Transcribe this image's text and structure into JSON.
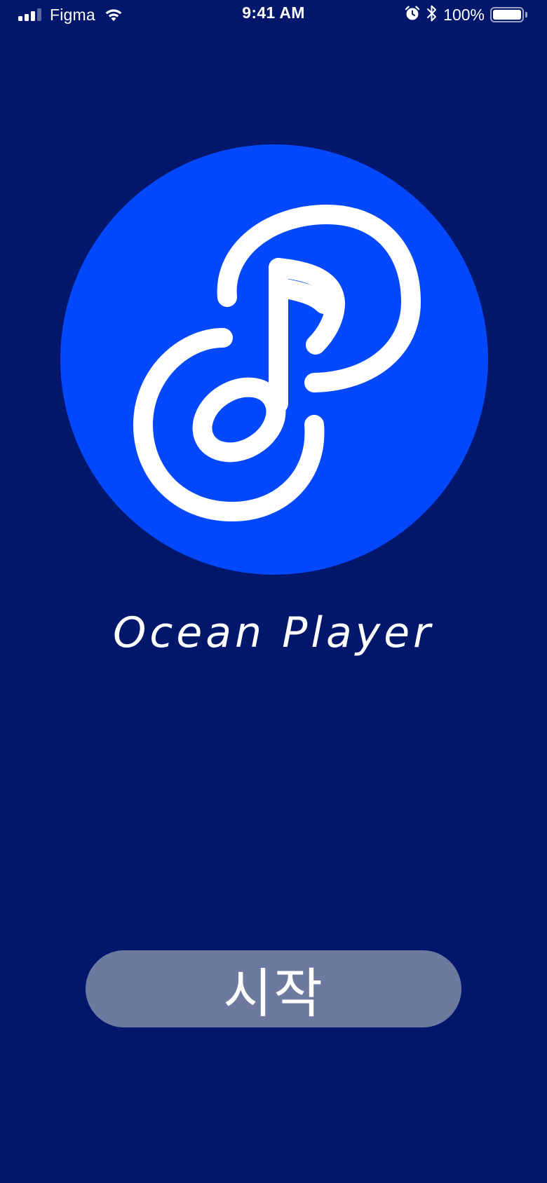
{
  "status_bar": {
    "carrier": "Figma",
    "time": "9:41 AM",
    "battery_percent": "100%",
    "icons": [
      "signal-icon",
      "wifi-icon",
      "alarm-icon",
      "bluetooth-icon",
      "battery-icon"
    ]
  },
  "app": {
    "name": "Ocean Player",
    "logo_icon": "music-note-icon"
  },
  "start_button": {
    "label": "시작"
  },
  "colors": {
    "background": "#00176b",
    "logo_circle": "#0348fd",
    "button": "#6d799f",
    "text": "#ffffff"
  }
}
